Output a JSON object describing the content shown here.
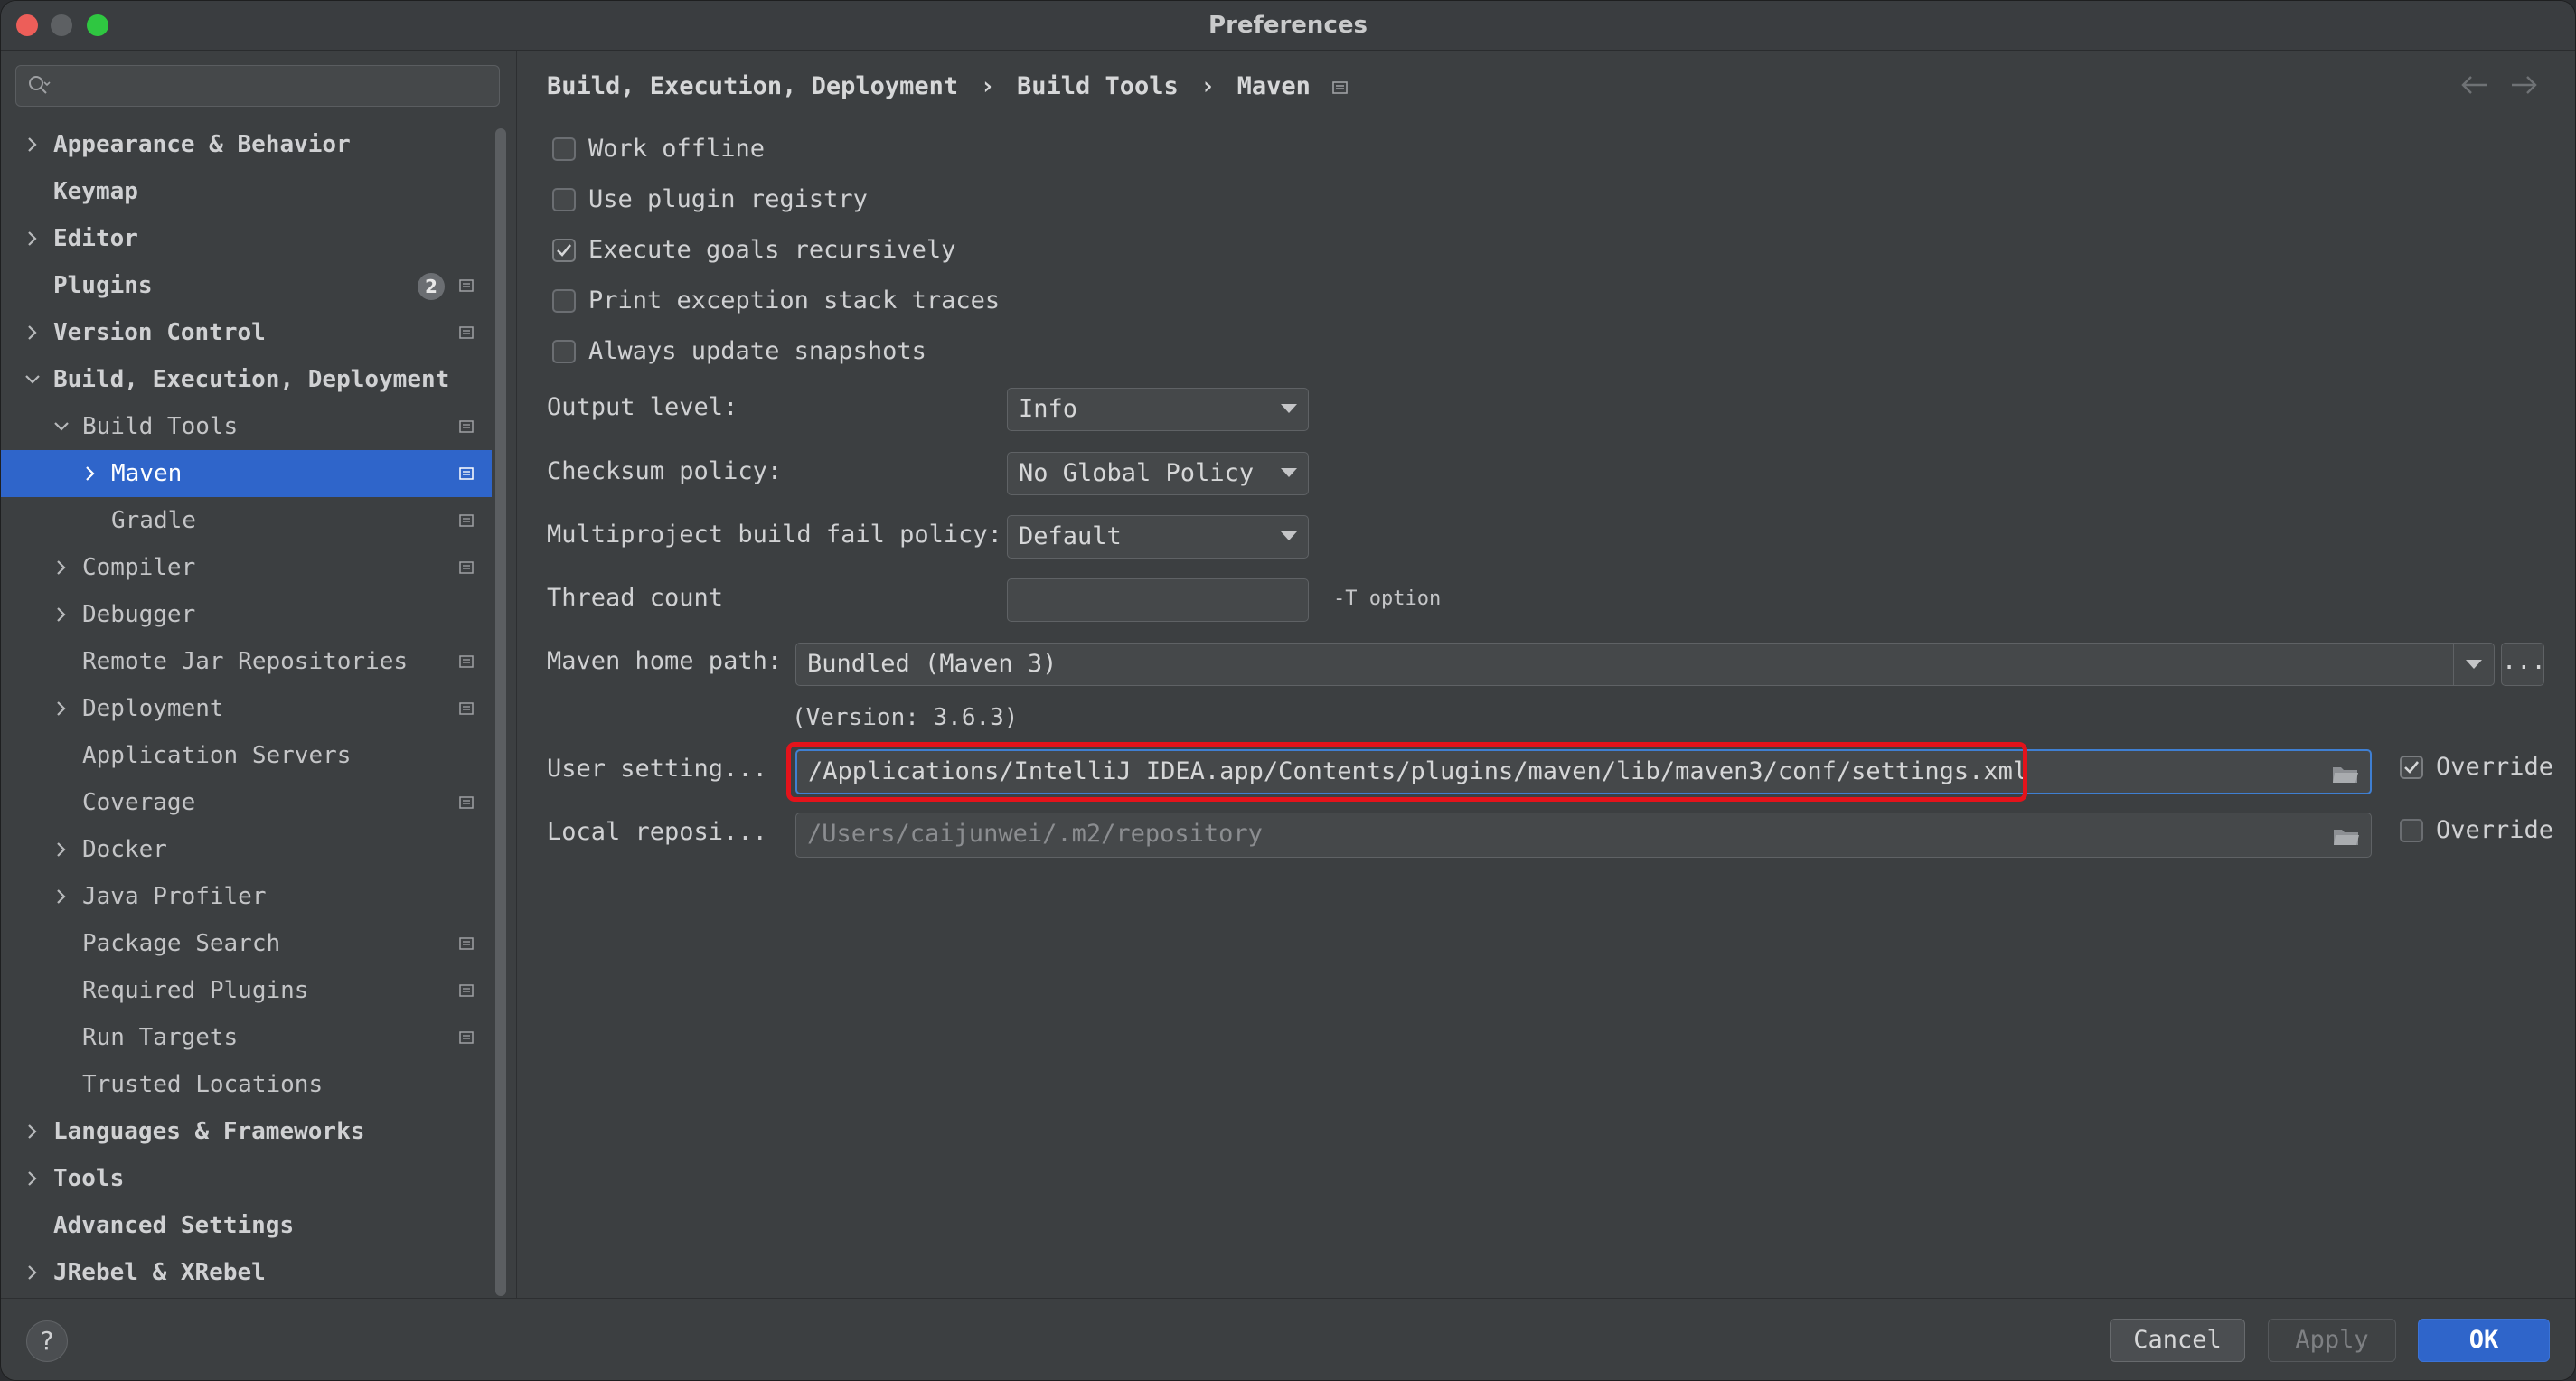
{
  "window": {
    "title": "Preferences"
  },
  "sidebar": {
    "search_placeholder": "",
    "items": [
      {
        "label": "Appearance & Behavior",
        "level": 0,
        "expandable": true,
        "expanded": false,
        "top_level": true
      },
      {
        "label": "Keymap",
        "level": 0,
        "expandable": false,
        "top_level": true
      },
      {
        "label": "Editor",
        "level": 0,
        "expandable": true,
        "expanded": false,
        "top_level": true
      },
      {
        "label": "Plugins",
        "level": 0,
        "expandable": false,
        "top_level": true,
        "badge": "2",
        "icon": true
      },
      {
        "label": "Version Control",
        "level": 0,
        "expandable": true,
        "expanded": false,
        "top_level": true,
        "icon": true
      },
      {
        "label": "Build, Execution, Deployment",
        "level": 0,
        "expandable": true,
        "expanded": true,
        "top_level": true
      },
      {
        "label": "Build Tools",
        "level": 1,
        "expandable": true,
        "expanded": true,
        "icon": true
      },
      {
        "label": "Maven",
        "level": 2,
        "expandable": true,
        "expanded": false,
        "selected": true,
        "icon": true
      },
      {
        "label": "Gradle",
        "level": 2,
        "expandable": false,
        "icon": true
      },
      {
        "label": "Compiler",
        "level": 1,
        "expandable": true,
        "expanded": false,
        "icon": true
      },
      {
        "label": "Debugger",
        "level": 1,
        "expandable": true,
        "expanded": false
      },
      {
        "label": "Remote Jar Repositories",
        "level": 1,
        "expandable": false,
        "icon": true
      },
      {
        "label": "Deployment",
        "level": 1,
        "expandable": true,
        "expanded": false,
        "icon": true
      },
      {
        "label": "Application Servers",
        "level": 1,
        "expandable": false
      },
      {
        "label": "Coverage",
        "level": 1,
        "expandable": false,
        "icon": true
      },
      {
        "label": "Docker",
        "level": 1,
        "expandable": true,
        "expanded": false
      },
      {
        "label": "Java Profiler",
        "level": 1,
        "expandable": true,
        "expanded": false
      },
      {
        "label": "Package Search",
        "level": 1,
        "expandable": false,
        "icon": true
      },
      {
        "label": "Required Plugins",
        "level": 1,
        "expandable": false,
        "icon": true
      },
      {
        "label": "Run Targets",
        "level": 1,
        "expandable": false,
        "icon": true
      },
      {
        "label": "Trusted Locations",
        "level": 1,
        "expandable": false
      },
      {
        "label": "Languages & Frameworks",
        "level": 0,
        "expandable": true,
        "expanded": false,
        "top_level": true
      },
      {
        "label": "Tools",
        "level": 0,
        "expandable": true,
        "expanded": false,
        "top_level": true
      },
      {
        "label": "Advanced Settings",
        "level": 0,
        "expandable": false,
        "top_level": true
      },
      {
        "label": "JRebel & XRebel",
        "level": 0,
        "expandable": true,
        "expanded": false,
        "top_level": true
      }
    ]
  },
  "breadcrumb": {
    "parts": [
      "Build, Execution, Deployment",
      "Build Tools",
      "Maven"
    ],
    "separator": "›"
  },
  "checkboxes": [
    {
      "label": "Work offline",
      "checked": false
    },
    {
      "label": "Use plugin registry",
      "checked": false
    },
    {
      "label": "Execute goals recursively",
      "checked": true
    },
    {
      "label": "Print exception stack traces",
      "checked": false
    },
    {
      "label": "Always update snapshots",
      "checked": false
    }
  ],
  "fields": {
    "output_level": {
      "label": "Output level:",
      "value": "Info"
    },
    "checksum_policy": {
      "label": "Checksum policy:",
      "value": "No Global Policy"
    },
    "multiproject_policy": {
      "label": "Multiproject build fail policy:",
      "value": "Default"
    },
    "thread_count": {
      "label": "Thread count",
      "value": "",
      "hint": "-T option"
    },
    "maven_home": {
      "label": "Maven home path:",
      "value": "Bundled (Maven 3)",
      "browse_label": "...",
      "version": "(Version: 3.6.3)"
    },
    "user_settings": {
      "label": "User setting...",
      "value": "/Applications/IntelliJ IDEA.app/Contents/plugins/maven/lib/maven3/conf/settings.xml",
      "override_label": "Override",
      "override_checked": true
    },
    "local_repo": {
      "label": "Local reposi...",
      "value": "/Users/caijunwei/.m2/repository",
      "override_label": "Override",
      "override_checked": false
    }
  },
  "footer": {
    "help_label": "?",
    "cancel_label": "Cancel",
    "apply_label": "Apply",
    "ok_label": "OK"
  },
  "colors": {
    "accent": "#2f65ca",
    "highlight_frame": "#e3131b",
    "background": "#3c3f41"
  }
}
